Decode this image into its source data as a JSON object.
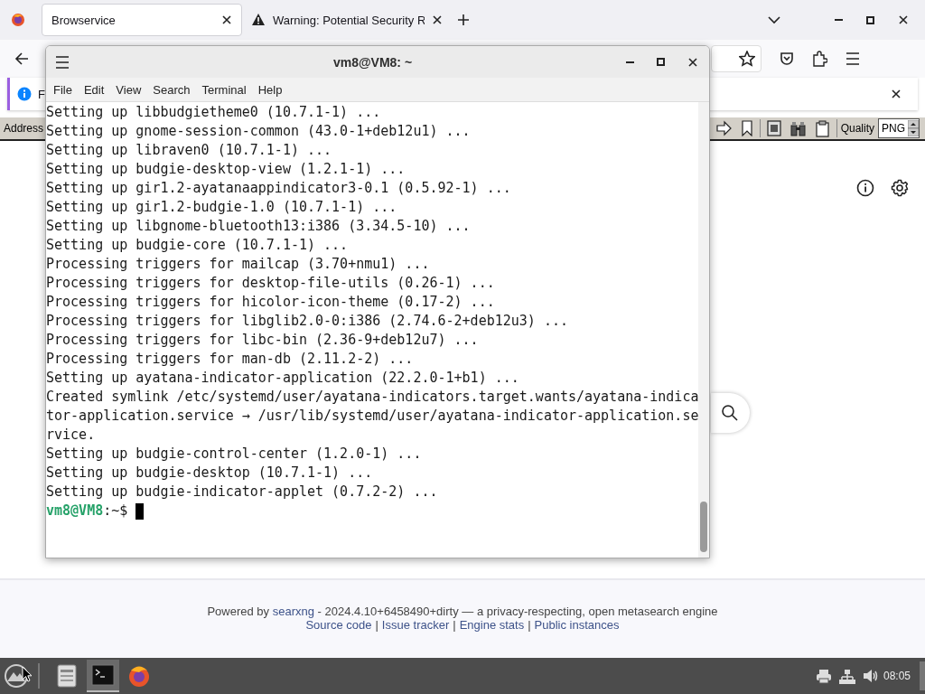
{
  "browser": {
    "tabs": [
      {
        "title": "Browservice",
        "selected": true,
        "kind": "plain"
      },
      {
        "title": "Warning: Potential Security R",
        "selected": false,
        "kind": "warning"
      }
    ],
    "notification": {
      "text": "F"
    },
    "toolbar": {
      "address_label": "Address",
      "quality_label": "Quality",
      "quality_value": "PNG"
    },
    "footer": {
      "powered_by": "Powered by",
      "engine_link": "searxng",
      "version_text": "- 2024.4.10+6458490+dirty — a privacy-respecting, open metasearch engine",
      "links": [
        "Source code",
        "Issue tracker",
        "Engine stats",
        "Public instances"
      ],
      "link_separator": "|"
    }
  },
  "terminal": {
    "title": "vm8@VM8: ~",
    "menu": [
      "File",
      "Edit",
      "View",
      "Search",
      "Terminal",
      "Help"
    ],
    "lines": [
      "Setting up libbudgietheme0 (10.7.1-1) ...",
      "Setting up gnome-session-common (43.0-1+deb12u1) ...",
      "Setting up libraven0 (10.7.1-1) ...",
      "Setting up budgie-desktop-view (1.2.1-1) ...",
      "Setting up gir1.2-ayatanaappindicator3-0.1 (0.5.92-1) ...",
      "Setting up gir1.2-budgie-1.0 (10.7.1-1) ...",
      "Setting up libgnome-bluetooth13:i386 (3.34.5-10) ...",
      "Setting up budgie-core (10.7.1-1) ...",
      "Processing triggers for mailcap (3.70+nmu1) ...",
      "Processing triggers for desktop-file-utils (0.26-1) ...",
      "Processing triggers for hicolor-icon-theme (0.17-2) ...",
      "Processing triggers for libglib2.0-0:i386 (2.74.6-2+deb12u3) ...",
      "Processing triggers for libc-bin (2.36-9+deb12u7) ...",
      "Processing triggers for man-db (2.11.2-2) ...",
      "Setting up ayatana-indicator-application (22.2.0-1+b1) ...",
      "Created symlink /etc/systemd/user/ayatana-indicators.target.wants/ayatana-indica",
      "tor-application.service → /usr/lib/systemd/user/ayatana-indicator-application.se",
      "rvice.",
      "Setting up budgie-control-center (1.2.0-1) ...",
      "Setting up budgie-desktop (10.7.1-1) ...",
      "Setting up budgie-indicator-applet (0.7.2-2) ..."
    ],
    "prompt": {
      "user_host": "vm8@VM8",
      "path": ":~$"
    }
  },
  "taskbar": {
    "apps": [
      {
        "kind": "files",
        "active": false
      },
      {
        "kind": "terminal",
        "active": true
      },
      {
        "kind": "firefox",
        "active": false
      }
    ],
    "clock": "08:05"
  }
}
